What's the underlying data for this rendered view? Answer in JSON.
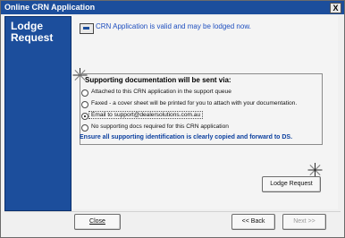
{
  "window": {
    "title": "Online CRN Application",
    "close_label": "X"
  },
  "sidebar": {
    "heading_line1": "Lodge",
    "heading_line2": "Request"
  },
  "status": {
    "message": "CRN Application is valid and may be lodged now."
  },
  "support_docs": {
    "title": "Supporting documentation will be sent via:",
    "options": [
      {
        "label": "Attached to this CRN application in the support queue",
        "selected": false
      },
      {
        "label": "Faxed - a cover sheet will be printed for you to attach with your documentation.",
        "selected": false
      },
      {
        "label": "Email to support@dealersolutions.com.au",
        "selected": true
      },
      {
        "label": "No supporting docs required for this CRN application",
        "selected": false
      }
    ]
  },
  "note": "Ensure all supporting identification is clearly copied and forward to DS.",
  "buttons": {
    "lodge_request": "Lodge Request",
    "close": "Close",
    "back": "<< Back",
    "next": "Next >>"
  }
}
